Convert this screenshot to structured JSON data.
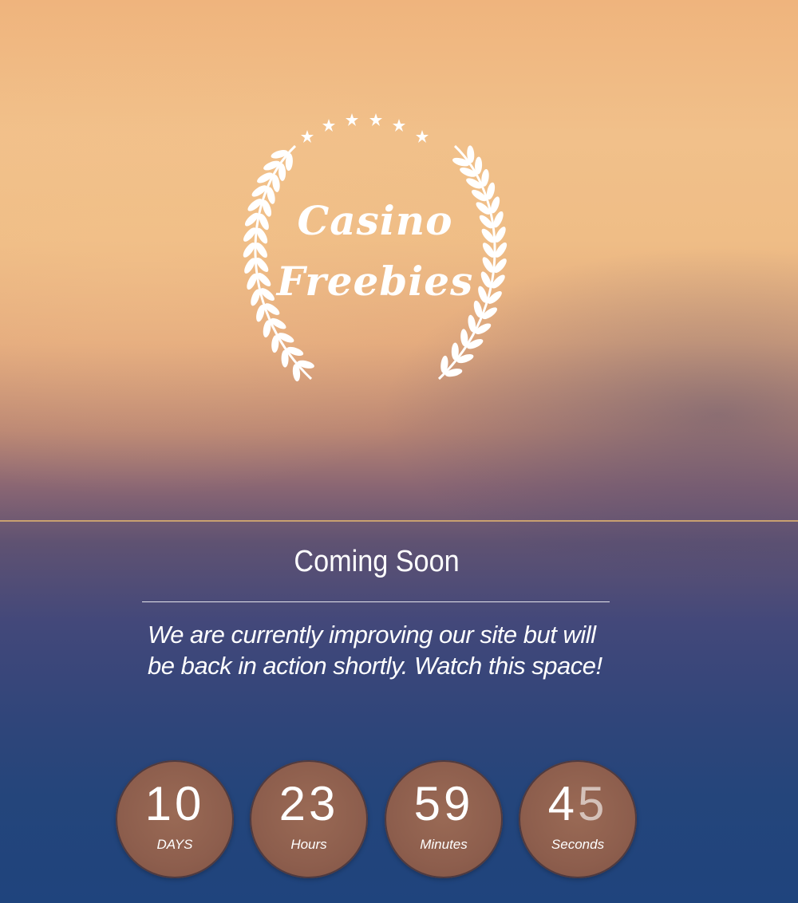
{
  "logo": {
    "line1": "Casino",
    "line2": "Freebies"
  },
  "headline": "Coming Soon",
  "message": "We are currently improving our site but will be back in action shortly. Watch this space!",
  "countdown": {
    "days": {
      "value": "10",
      "label": "DAYS"
    },
    "hours": {
      "value": "23",
      "label": "Hours"
    },
    "minutes": {
      "value": "59",
      "label": "Minutes"
    },
    "seconds": {
      "value_first": "4",
      "value_second": "5",
      "label": "Seconds"
    }
  },
  "colors": {
    "top": "#efb47d",
    "bottom": "#1f447d",
    "divider": "#c9a070",
    "counter_bg": "#8d5e4d"
  }
}
